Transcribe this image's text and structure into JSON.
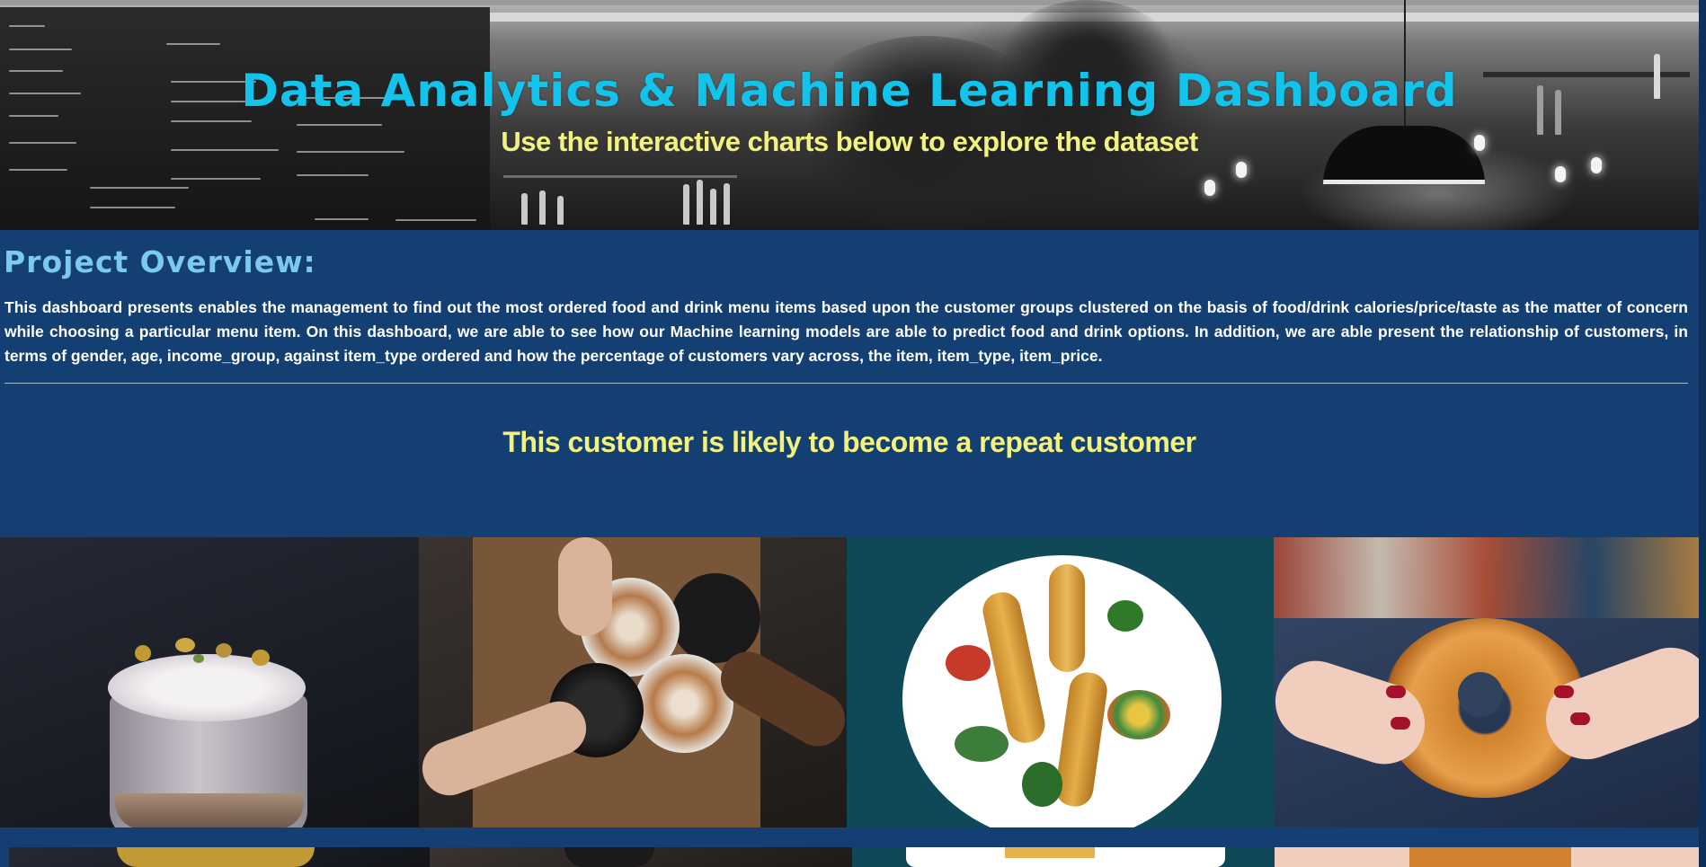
{
  "banner": {
    "title": "Data Analytics & Machine Learning Dashboard",
    "subtitle": "Use the interactive charts below to explore the dataset"
  },
  "overview": {
    "heading": "Project Overview:",
    "text": "This dashboard presents enables the management to find out the most ordered food and drink menu items based upon the customer groups clustered on the basis of food/drink calories/price/taste as the matter of concern while choosing a particular menu item. On this dashboard, we are able to see how our Machine learning models are able to predict food and drink options. In addition, we are able present the relationship of customers, in terms of gender, age, income_group, against item_type ordered and how the percentage of customers vary across, the item, item_type, item_price."
  },
  "prediction": {
    "text": "This customer is likely to become a repeat customer"
  },
  "images": [
    {
      "name": "dessert-cup-photo"
    },
    {
      "name": "coffee-cheers-photo"
    },
    {
      "name": "chicken-skewer-plate-photo"
    },
    {
      "name": "donut-hands-photo"
    }
  ],
  "colors": {
    "background": "#143f73",
    "title": "#12c3ec",
    "accent_yellow": "#f3f27e",
    "heading_blue": "#7cc9ee"
  }
}
